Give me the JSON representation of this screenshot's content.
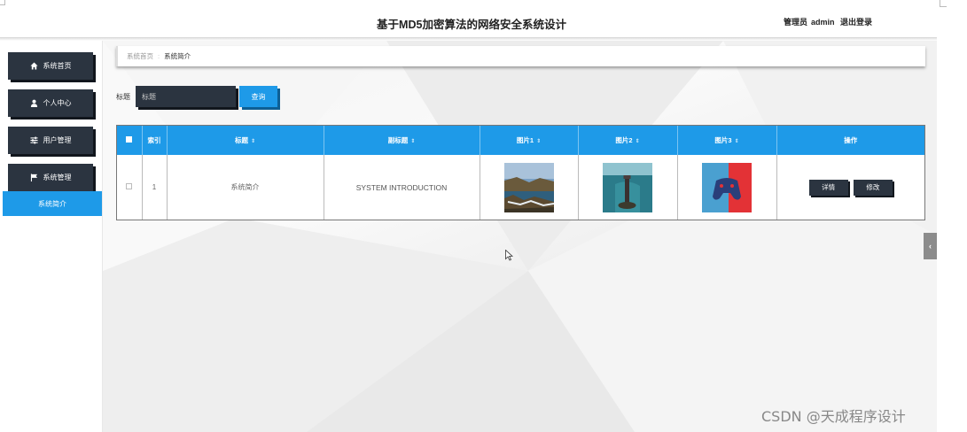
{
  "header": {
    "title": "基于MD5加密算法的网络安全系统设计",
    "role_label": "管理员",
    "username": "admin",
    "logout_label": "退出登录"
  },
  "sidebar": {
    "items": [
      {
        "label": "系统首页",
        "icon": "home-icon"
      },
      {
        "label": "个人中心",
        "icon": "user-icon"
      },
      {
        "label": "用户管理",
        "icon": "sliders-icon"
      },
      {
        "label": "系统管理",
        "icon": "flag-icon"
      }
    ],
    "active_sub_item": "系统简介"
  },
  "breadcrumb": {
    "home": "系统首页",
    "separator": ":",
    "current": "系统简介"
  },
  "search": {
    "label": "标题",
    "placeholder": "标题",
    "button_label": "查询"
  },
  "table": {
    "columns": [
      "索引",
      "标题",
      "副标题",
      "图片1",
      "图片2",
      "图片3",
      "操作"
    ],
    "rows": [
      {
        "index": "1",
        "title": "系统简介",
        "subtitle": "SYSTEM INTRODUCTION",
        "images": [
          "coastal-landscape-image",
          "lighthouse-sea-image",
          "gamepad-image"
        ],
        "actions": [
          "详情",
          "修改"
        ]
      }
    ]
  },
  "colors": {
    "accent": "#1e9ae8",
    "dark": "#2b3440"
  },
  "side_tab_icon": "chevron-left-icon",
  "watermark": "CSDN @天成程序设计"
}
